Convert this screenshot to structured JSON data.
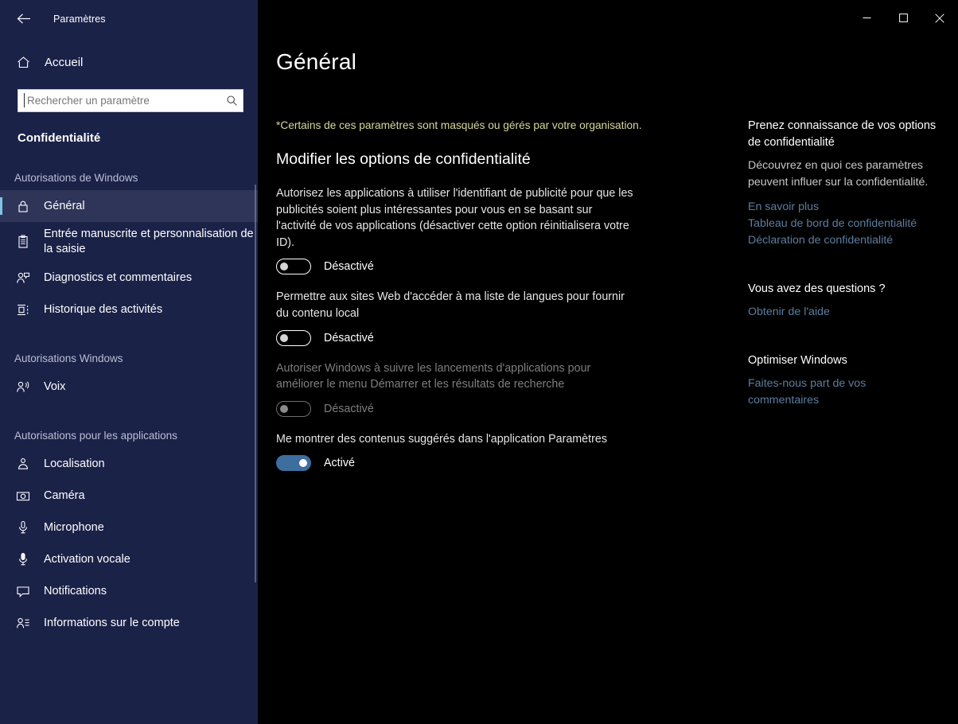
{
  "window": {
    "app_title": "Paramètres",
    "back_icon": "back-arrow-icon",
    "minimize_label": "—",
    "maximize_label": "□",
    "close_label": "✕"
  },
  "sidebar": {
    "home": {
      "label": "Accueil",
      "icon": "home-icon"
    },
    "search": {
      "placeholder": "Rechercher un paramètre",
      "value": "",
      "icon": "search-icon"
    },
    "category_title": "Confidentialité",
    "groups": [
      {
        "header": "Autorisations de Windows",
        "items": [
          {
            "label": "Général",
            "icon": "lock-icon",
            "selected": true
          },
          {
            "label": "Entrée manuscrite et personnalisation de la saisie",
            "icon": "clipboard-icon",
            "selected": false
          },
          {
            "label": "Diagnostics et commentaires",
            "icon": "person-feedback-icon",
            "selected": false
          },
          {
            "label": "Historique des activités",
            "icon": "activity-history-icon",
            "selected": false
          }
        ]
      },
      {
        "header": "Autorisations Windows",
        "items": [
          {
            "label": "Voix",
            "icon": "person-speaking-icon",
            "selected": false
          }
        ]
      },
      {
        "header": "Autorisations pour les applications",
        "items": [
          {
            "label": "Localisation",
            "icon": "location-pin-icon",
            "selected": false
          },
          {
            "label": "Caméra",
            "icon": "camera-icon",
            "selected": false
          },
          {
            "label": "Microphone",
            "icon": "microphone-icon",
            "selected": false
          },
          {
            "label": "Activation vocale",
            "icon": "voice-activation-icon",
            "selected": false
          },
          {
            "label": "Notifications",
            "icon": "notification-icon",
            "selected": false
          },
          {
            "label": "Informations sur le compte",
            "icon": "account-info-icon",
            "selected": false
          }
        ]
      }
    ]
  },
  "main": {
    "page_title": "Général",
    "org_note": "*Certains de ces paramètres sont masqués ou gérés par votre organisation.",
    "section_heading": "Modifier les options de confidentialité",
    "settings": [
      {
        "description": "Autorisez les applications à utiliser l'identifiant de publicité pour que les publicités soient plus intéressantes pour vous en se basant sur l'activité de vos applications (désactiver cette option réinitialisera votre ID).",
        "state_label": "Désactivé",
        "on": false,
        "disabled": false
      },
      {
        "description": "Permettre aux sites Web d'accéder à ma liste de langues pour fournir du contenu local",
        "state_label": "Désactivé",
        "on": false,
        "disabled": false
      },
      {
        "description": "Autoriser Windows à suivre les lancements d'applications pour améliorer le menu Démarrer et les résultats de recherche",
        "state_label": "Désactivé",
        "on": false,
        "disabled": true
      },
      {
        "description": "Me montrer des contenus suggérés dans l'application Paramètres",
        "state_label": "Activé",
        "on": true,
        "disabled": false
      }
    ]
  },
  "help": {
    "groups": [
      {
        "title": "Prenez connaissance de vos options de confidentialité",
        "body": "Découvrez en quoi ces paramètres peuvent influer sur la confidentialité.",
        "links": [
          "En savoir plus",
          "Tableau de bord de confidentialité",
          "Déclaration de confidentialité"
        ]
      },
      {
        "title": "Vous avez des questions ?",
        "body": "",
        "links": [
          "Obtenir de l'aide"
        ]
      },
      {
        "title": "Optimiser Windows",
        "body": "",
        "links": [
          "Faites-nous part de vos commentaires"
        ]
      }
    ]
  },
  "colors": {
    "sidebar_bg": "#1b2248",
    "content_bg": "#000000",
    "accent_selected": "#7fc3e8",
    "toggle_on": "#3d6e9e",
    "link": "#5c7ea0",
    "org_note": "#d7d79b"
  }
}
